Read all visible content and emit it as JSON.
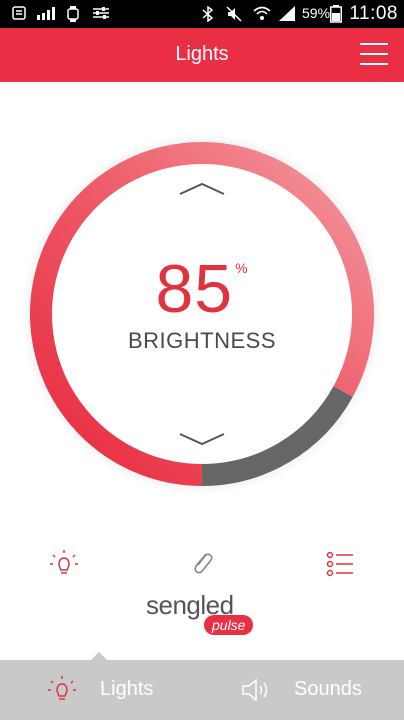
{
  "status_bar": {
    "battery_percent": "59%",
    "clock": "11:08"
  },
  "app_bar": {
    "title": "Lights"
  },
  "dial": {
    "value": "85",
    "unit": "%",
    "label": "BRIGHTNESS",
    "level_fraction": 0.85,
    "colors": {
      "arc_start": "#e8283c",
      "arc_end": "#f39aa0",
      "remainder": "#666666"
    }
  },
  "tools": [
    "bulb-icon",
    "paperclip-icon",
    "list-icon"
  ],
  "logo": {
    "wordmark": "sengled",
    "badge": "pulse"
  },
  "bottom_nav": {
    "tabs": [
      {
        "label": "Lights",
        "icon": "bulb-icon",
        "active": true
      },
      {
        "label": "Sounds",
        "icon": "speaker-icon",
        "active": false
      }
    ]
  },
  "colors": {
    "accent": "#ea2f45",
    "nav_background": "#c9c9c9"
  }
}
